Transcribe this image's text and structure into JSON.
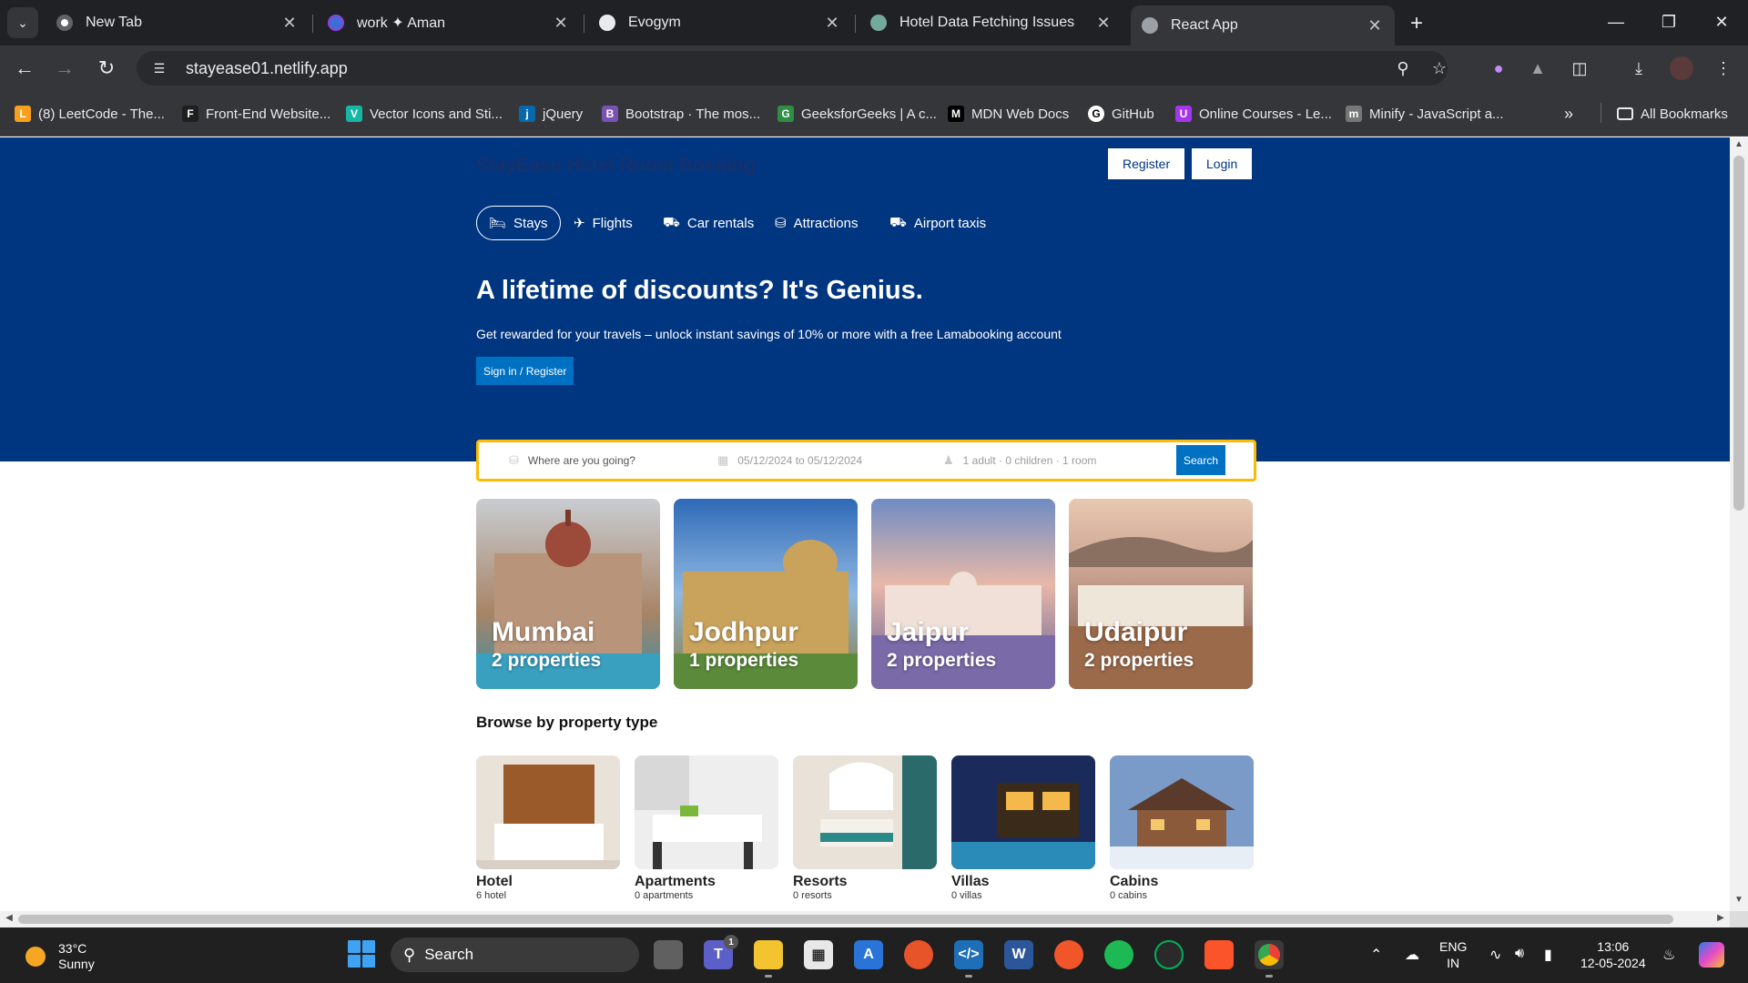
{
  "browser": {
    "tabs": [
      {
        "title": "New Tab",
        "favicon": "chrome-icon"
      },
      {
        "title": "work ✦ Aman",
        "favicon": "app-icon"
      },
      {
        "title": "Evogym",
        "favicon": "evogym-icon"
      },
      {
        "title": "Hotel Data Fetching Issues",
        "favicon": "chatgpt-icon"
      },
      {
        "title": "React App",
        "favicon": "globe-icon",
        "active": true
      }
    ],
    "url": "stayease01.netlify.app",
    "bookmarks": [
      {
        "label": "(8) LeetCode - The...",
        "color": "#f89f1b"
      },
      {
        "label": "Front-End Website...",
        "color": "#1e1e1e"
      },
      {
        "label": "Vector Icons and Sti...",
        "color": "#16b6a4"
      },
      {
        "label": "jQuery",
        "color": "#0868ac"
      },
      {
        "label": "Bootstrap · The mos...",
        "color": "#7952b3"
      },
      {
        "label": "GeeksforGeeks | A c...",
        "color": "#2f8d46"
      },
      {
        "label": "MDN Web Docs",
        "color": "#000000"
      },
      {
        "label": "GitHub",
        "color": "#ffffff"
      },
      {
        "label": "Online Courses - Le...",
        "color": "#a435f0"
      },
      {
        "label": "Minify - JavaScript a...",
        "color": "#777777"
      }
    ],
    "all_bookmarks_label": "All Bookmarks"
  },
  "page": {
    "logo": "StayEase Hotel Room Booking",
    "register_label": "Register",
    "login_label": "Login",
    "nav": [
      {
        "label": "Stays",
        "icon": "bed-icon",
        "active": true
      },
      {
        "label": "Flights",
        "icon": "plane-icon"
      },
      {
        "label": "Car rentals",
        "icon": "car-icon"
      },
      {
        "label": "Attractions",
        "icon": "bed-icon"
      },
      {
        "label": "Airport taxis",
        "icon": "taxi-icon"
      }
    ],
    "hero_title": "A lifetime of discounts? It's Genius.",
    "hero_desc": "Get rewarded for your travels – unlock instant savings of 10% or more with a free Lamabooking account",
    "hero_button": "Sign in / Register",
    "search": {
      "destination_placeholder": "Where are you going?",
      "dates": "05/12/2024 to 05/12/2024",
      "options": "1 adult · 0 children · 1 room",
      "button": "Search"
    },
    "featured": [
      {
        "city": "Mumbai",
        "count": "2 properties"
      },
      {
        "city": "Jodhpur",
        "count": "1 properties"
      },
      {
        "city": "Jaipur",
        "count": "2 properties"
      },
      {
        "city": "Udaipur",
        "count": "2 properties"
      }
    ],
    "property_section_title": "Browse by property type",
    "property_types": [
      {
        "name": "Hotel",
        "count": "6 hotel"
      },
      {
        "name": "Apartments",
        "count": "0 apartments"
      },
      {
        "name": "Resorts",
        "count": "0 resorts"
      },
      {
        "name": "Villas",
        "count": "0 villas"
      },
      {
        "name": "Cabins",
        "count": "0 cabins"
      }
    ]
  },
  "taskbar": {
    "temperature": "33°C",
    "weather": "Sunny",
    "search_label": "Search",
    "language": "ENG",
    "region": "IN",
    "time": "13:06",
    "date": "12-05-2024",
    "teams_badge": "1"
  },
  "colors": {
    "header_blue": "#003580",
    "button_blue": "#0071c2",
    "search_border": "#febb02"
  }
}
